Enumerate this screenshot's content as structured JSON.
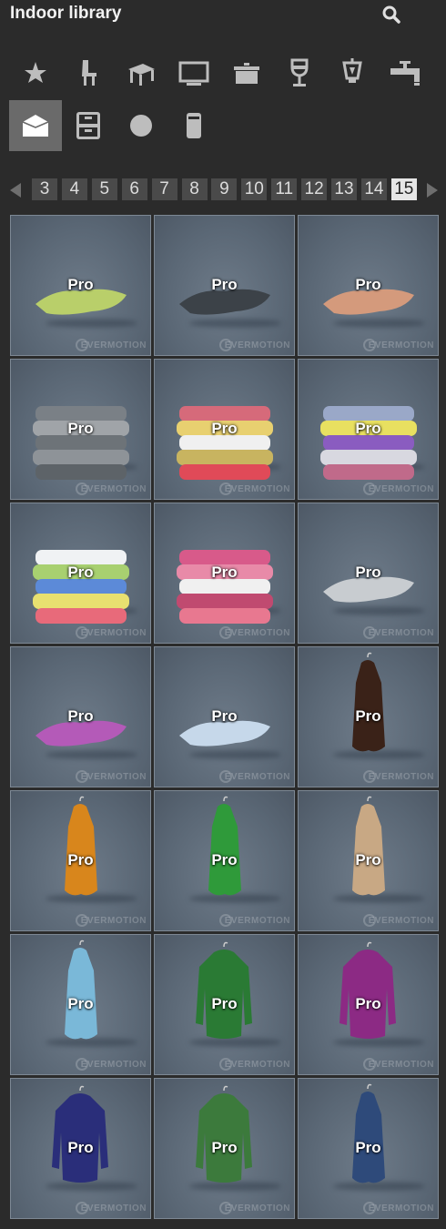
{
  "header": {
    "title": "Indoor library",
    "search_icon": "search-icon"
  },
  "categories": [
    {
      "icon": "star-icon",
      "active": false
    },
    {
      "icon": "chair-icon",
      "active": false
    },
    {
      "icon": "table-icon",
      "active": false
    },
    {
      "icon": "tv-icon",
      "active": false
    },
    {
      "icon": "pot-icon",
      "active": false
    },
    {
      "icon": "wine-glass-icon",
      "active": false
    },
    {
      "icon": "lamp-icon",
      "active": false
    },
    {
      "icon": "faucet-icon",
      "active": false
    },
    {
      "icon": "clothing-box-icon",
      "active": true
    },
    {
      "icon": "cabinet-icon",
      "active": false
    },
    {
      "icon": "circle-icon",
      "active": false
    },
    {
      "icon": "bin-icon",
      "active": false
    }
  ],
  "pagination": {
    "prev_icon": "arrow-left-icon",
    "next_icon": "arrow-right-icon",
    "pages": [
      "3",
      "4",
      "5",
      "6",
      "7",
      "8",
      "9",
      "10",
      "11",
      "12",
      "13",
      "14",
      "15"
    ],
    "current": "15"
  },
  "items": [
    {
      "badge": "Pro",
      "watermark": "EVERMOTION",
      "kind": "flat",
      "color": "#b9cf6a"
    },
    {
      "badge": "Pro",
      "watermark": "EVERMOTION",
      "kind": "flat",
      "color": "#3c4248"
    },
    {
      "badge": "Pro",
      "watermark": "EVERMOTION",
      "kind": "flat",
      "color": "#d49a7c"
    },
    {
      "badge": "Pro",
      "watermark": "EVERMOTION",
      "kind": "stack",
      "colors": [
        "#7a8086",
        "#a0a4a8",
        "#6d7378",
        "#8e9398",
        "#5d6368"
      ]
    },
    {
      "badge": "Pro",
      "watermark": "EVERMOTION",
      "kind": "stack",
      "colors": [
        "#d66a7a",
        "#e8d070",
        "#f0f0f0",
        "#c8b460",
        "#e04a58"
      ]
    },
    {
      "badge": "Pro",
      "watermark": "EVERMOTION",
      "kind": "stack",
      "colors": [
        "#9aa8c8",
        "#e8e060",
        "#8a5cc0",
        "#d8d8e0",
        "#c06a8a"
      ]
    },
    {
      "badge": "Pro",
      "watermark": "EVERMOTION",
      "kind": "stack",
      "colors": [
        "#f0f2f4",
        "#a8d070",
        "#5c8ad8",
        "#e8e070",
        "#e86a7a"
      ]
    },
    {
      "badge": "Pro",
      "watermark": "EVERMOTION",
      "kind": "stack",
      "colors": [
        "#d85a8a",
        "#e88aa8",
        "#f0f0f0",
        "#c04a70",
        "#e87890"
      ]
    },
    {
      "badge": "Pro",
      "watermark": "EVERMOTION",
      "kind": "flat",
      "color": "#c8ccd0"
    },
    {
      "badge": "Pro",
      "watermark": "EVERMOTION",
      "kind": "flat",
      "color": "#b45ab8"
    },
    {
      "badge": "Pro",
      "watermark": "EVERMOTION",
      "kind": "flat",
      "color": "#c6d8ea"
    },
    {
      "badge": "Pro",
      "watermark": "EVERMOTION",
      "kind": "hang",
      "color": "#3a2218"
    },
    {
      "badge": "Pro",
      "watermark": "EVERMOTION",
      "kind": "hang",
      "color": "#d8861c"
    },
    {
      "badge": "Pro",
      "watermark": "EVERMOTION",
      "kind": "hang",
      "color": "#2f9a3a"
    },
    {
      "badge": "Pro",
      "watermark": "EVERMOTION",
      "kind": "hang",
      "color": "#c8a884"
    },
    {
      "badge": "Pro",
      "watermark": "EVERMOTION",
      "kind": "hang",
      "color": "#7ab8d8"
    },
    {
      "badge": "Pro",
      "watermark": "EVERMOTION",
      "kind": "coat",
      "color": "#2a7a34"
    },
    {
      "badge": "Pro",
      "watermark": "EVERMOTION",
      "kind": "coat",
      "color": "#8c2a84"
    },
    {
      "badge": "Pro",
      "watermark": "EVERMOTION",
      "kind": "coat",
      "color": "#2a2e7a"
    },
    {
      "badge": "Pro",
      "watermark": "EVERMOTION",
      "kind": "coat",
      "color": "#3c7a3c"
    },
    {
      "badge": "Pro",
      "watermark": "EVERMOTION",
      "kind": "hang",
      "color": "#2e4a7a"
    }
  ]
}
